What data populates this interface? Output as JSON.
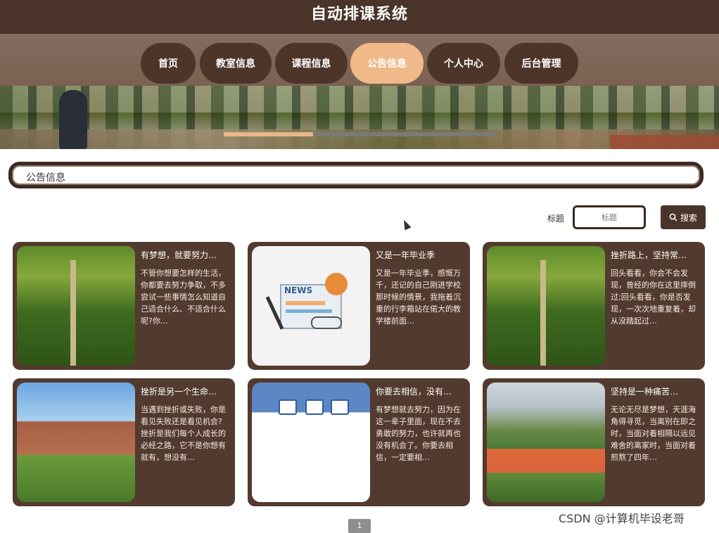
{
  "app": {
    "title": "自动排课系统"
  },
  "nav": {
    "items": [
      {
        "label": "首页"
      },
      {
        "label": "教室信息"
      },
      {
        "label": "课程信息"
      },
      {
        "label": "公告信息",
        "active": true
      },
      {
        "label": "个人中心"
      },
      {
        "label": "后台管理"
      }
    ],
    "active_color": "#efb989",
    "bar_color": "#4a3328"
  },
  "banner": {
    "slider_progress": 0.33
  },
  "section": {
    "title": "公告信息"
  },
  "search": {
    "label": "标题",
    "placeholder": "标题",
    "button_label": "搜索",
    "button_icon": "search-icon"
  },
  "cards": [
    {
      "title": "有梦想，就要努力…",
      "body": "不管你想要怎样的生活，你都要去努力争取，不多尝试一些事情怎么知道自己适合什么、不适合什么呢?你…",
      "image": "forest"
    },
    {
      "title": "又是一年毕业季",
      "body": "又是一年毕业季，感慨万千，还记的自己刚进学校那时候的情景，我拖着沉重的行李箱站在偌大的教学楼前面…",
      "image": "news"
    },
    {
      "title": "挫折路上，坚持常…",
      "body": "回头看看，你会不会发现，曾经的你在这里摔倒过;回头看看，你是否发现，一次次地重复着，却从没踏起过…",
      "image": "forest"
    },
    {
      "title": "挫折是另一个生命…",
      "body": "当遇到挫折或失败，你是看见失败还是看见机会?挫折是我们每个人成长的必经之路，它不是你想有就有，想没有…",
      "image": "campus"
    },
    {
      "title": "你要去相信，没有…",
      "body": "有梦想就去努力，因为在这一辈子里面，现在不去勇敢的努力，也许就再也没有机会了。你要去相信，一定要相…",
      "image": "building"
    },
    {
      "title": "坚持是一种痛苦…",
      "body": "无论无尽是梦想，天涯海角得寻觅，当离别在即之时，当面对着相隔以远见难舍的离家时，当面对着煎熬了四年…",
      "image": "track"
    }
  ],
  "pagination": {
    "current": "1"
  },
  "watermark": "CSDN @计算机毕设老哥"
}
